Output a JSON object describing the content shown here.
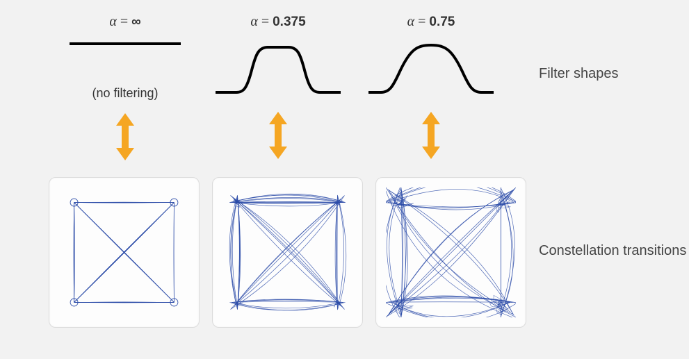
{
  "columns": [
    {
      "alpha_label_html": "α = ∞",
      "alpha_value": "∞",
      "subtext": "(no filtering)"
    },
    {
      "alpha_label_html": "α = 0.375",
      "alpha_value": "0.375",
      "subtext": ""
    },
    {
      "alpha_label_html": "α = 0.75",
      "alpha_value": "0.75",
      "subtext": ""
    }
  ],
  "side_labels": {
    "filter": "Filter shapes",
    "constellation": "Constellation transitions"
  },
  "colors": {
    "arrow": "#f5a623",
    "trace": "#2b4ba8",
    "filter_stroke": "#000000"
  }
}
